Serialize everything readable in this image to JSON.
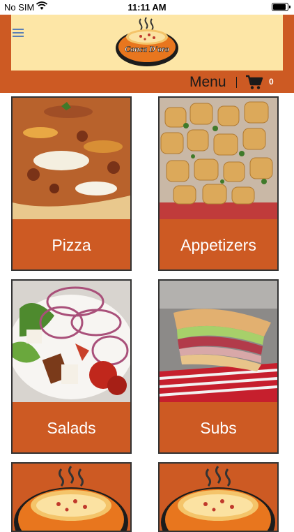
{
  "status_bar": {
    "carrier": "No SIM",
    "time": "11:11 AM"
  },
  "header": {
    "logo_text": "Conca D'oro",
    "menu_label": "Menu",
    "cart_count": "0"
  },
  "colors": {
    "brand_orange": "#cd5a23",
    "logo_panel": "#fde6a6"
  },
  "categories": [
    {
      "label": "Pizza"
    },
    {
      "label": "Appetizers"
    },
    {
      "label": "Salads"
    },
    {
      "label": "Subs"
    },
    {
      "label": ""
    },
    {
      "label": ""
    }
  ]
}
